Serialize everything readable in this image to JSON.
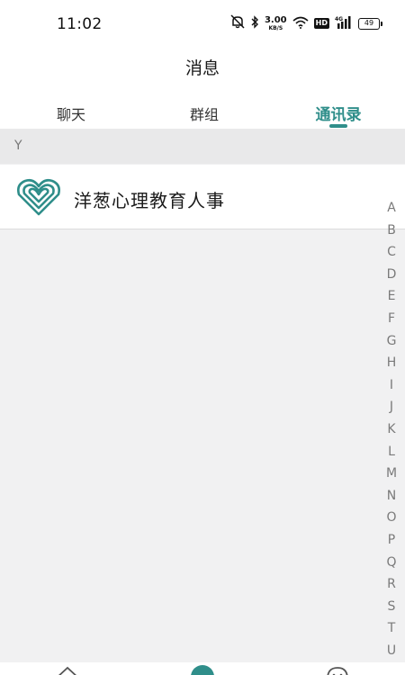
{
  "status_bar": {
    "time": "11:02",
    "speed_value": "3.00",
    "speed_unit": "KB/S",
    "hd_label": "HD",
    "network_label": "4G",
    "battery": "49"
  },
  "header": {
    "title": "消息"
  },
  "tabs": [
    {
      "label": "聊天",
      "active": false
    },
    {
      "label": "群组",
      "active": false
    },
    {
      "label": "通讯录",
      "active": true
    }
  ],
  "contacts": {
    "section_letter": "Y",
    "items": [
      {
        "name": "洋葱心理教育人事",
        "avatar_icon": "heart-logo-icon"
      }
    ]
  },
  "alpha_index": [
    "A",
    "B",
    "C",
    "D",
    "E",
    "F",
    "G",
    "H",
    "I",
    "J",
    "K",
    "L",
    "M",
    "N",
    "O",
    "P",
    "Q",
    "R",
    "S",
    "T",
    "U"
  ],
  "colors": {
    "accent": "#2f8e8a",
    "background": "#f1f1f2",
    "section_header": "#e9e9ea"
  },
  "bottom_nav": {
    "icons": [
      "home-icon",
      "center-action-icon",
      "profile-icon"
    ]
  }
}
